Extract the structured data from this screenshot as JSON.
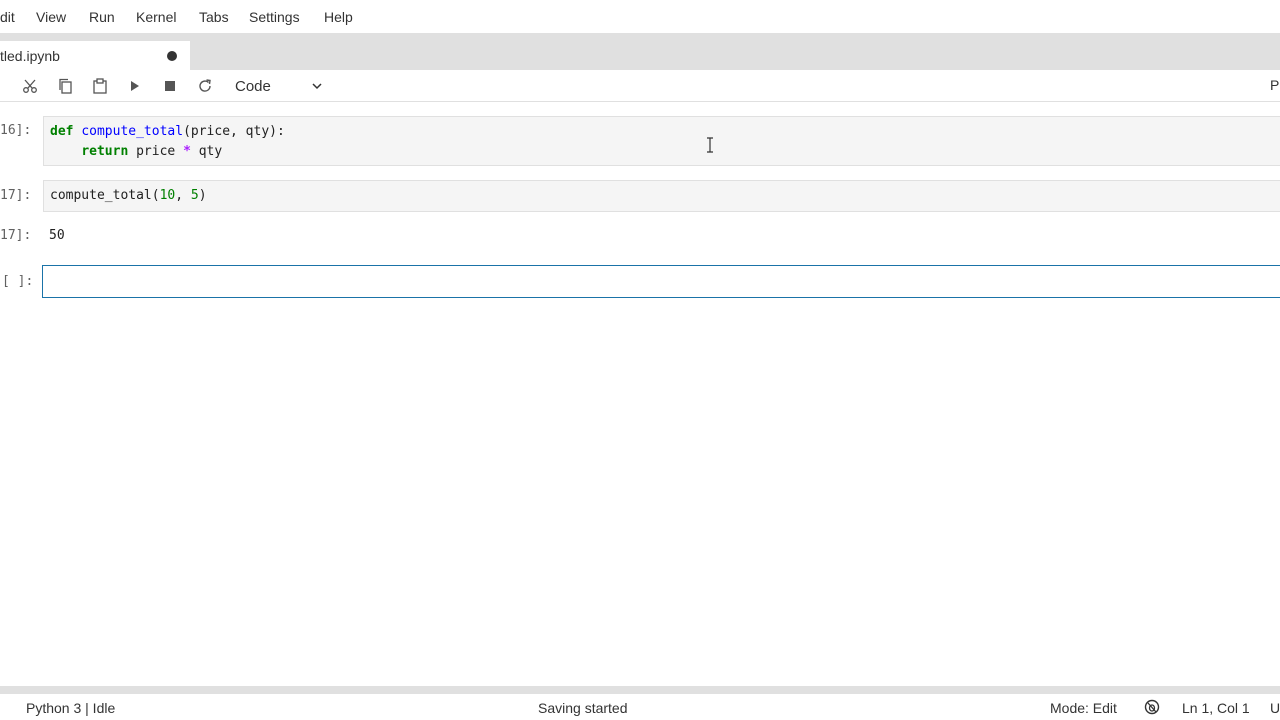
{
  "menu": {
    "items": [
      "dit",
      "View",
      "Run",
      "Kernel",
      "Tabs",
      "Settings",
      "Help"
    ]
  },
  "tab": {
    "label": "tled.ipynb",
    "unsaved_indicator": "dot"
  },
  "toolbar": {
    "icons": [
      "scissors-icon",
      "copy-icon",
      "paste-icon",
      "run-icon",
      "stop-icon",
      "restart-icon"
    ],
    "cell_type": "Code",
    "right_label": "P"
  },
  "cells": [
    {
      "prompt": "16]:",
      "code_lines": [
        "def compute_total(price, qty):",
        "    return price * qty"
      ]
    },
    {
      "prompt": "17]:",
      "code_lines": [
        "compute_total(10, 5)"
      ],
      "output_prompt": "17]:",
      "output": "50"
    },
    {
      "prompt": "[ ]:",
      "code_lines": [
        ""
      ]
    }
  ],
  "status": {
    "kernel": "Python 3 | Idle",
    "message": "Saving started",
    "mode": "Mode: Edit",
    "position": "Ln 1, Col 1",
    "encoding": "U"
  },
  "colors": {
    "active_cell_border": "#1a73a8",
    "keyword": "#008000",
    "function": "#0000ff",
    "operator": "#aa22ff",
    "number": "#008000"
  }
}
